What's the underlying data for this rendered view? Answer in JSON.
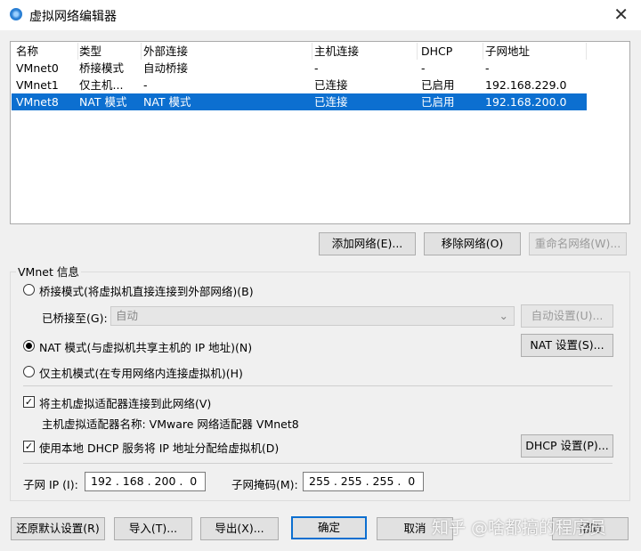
{
  "window": {
    "title": "虚拟网络编辑器",
    "close": "✕"
  },
  "table": {
    "columns": [
      "名称",
      "类型",
      "外部连接",
      "主机连接",
      "DHCP",
      "子网地址"
    ],
    "rows": [
      [
        "VMnet0",
        "桥接模式",
        "自动桥接",
        "-",
        "-",
        "-"
      ],
      [
        "VMnet1",
        "仅主机...",
        "-",
        "已连接",
        "已启用",
        "192.168.229.0"
      ],
      [
        "VMnet8",
        "NAT 模式",
        "NAT 模式",
        "已连接",
        "已启用",
        "192.168.200.0"
      ]
    ],
    "selected_index": 2
  },
  "list_buttons": {
    "add": "添加网络(E)...",
    "remove": "移除网络(O)",
    "rename": "重命名网络(W)..."
  },
  "info": {
    "group_label": "VMnet 信息",
    "bridge": "桥接模式(将虚拟机直接连接到外部网络)(B)",
    "bridged_to_label": "已桥接至(G):",
    "bridged_to_value": "自动",
    "auto_settings": "自动设置(U)...",
    "nat": "NAT 模式(与虚拟机共享主机的 IP 地址)(N)",
    "nat_settings": "NAT 设置(S)...",
    "host_only": "仅主机模式(在专用网络内连接虚拟机)(H)",
    "mode": "nat",
    "connect_adapter": "将主机虚拟适配器连接到此网络(V)",
    "connect_adapter_checked": true,
    "adapter_name": "主机虚拟适配器名称: VMware 网络适配器 VMnet8",
    "dhcp": "使用本地 DHCP 服务将 IP 地址分配给虚拟机(D)",
    "dhcp_checked": true,
    "dhcp_settings": "DHCP 设置(P)...",
    "subnet_ip_label": "子网 IP (I):",
    "subnet_ip": "192 . 168 . 200 .  0",
    "subnet_mask_label": "子网掩码(M):",
    "subnet_mask": "255 . 255 . 255 .  0"
  },
  "footer": {
    "restore": "还原默认设置(R)",
    "import": "导入(T)...",
    "export": "导出(X)...",
    "ok": "确定",
    "cancel": "取消",
    "help": "帮助"
  },
  "watermark": "知乎 @啥都搞的程序员"
}
